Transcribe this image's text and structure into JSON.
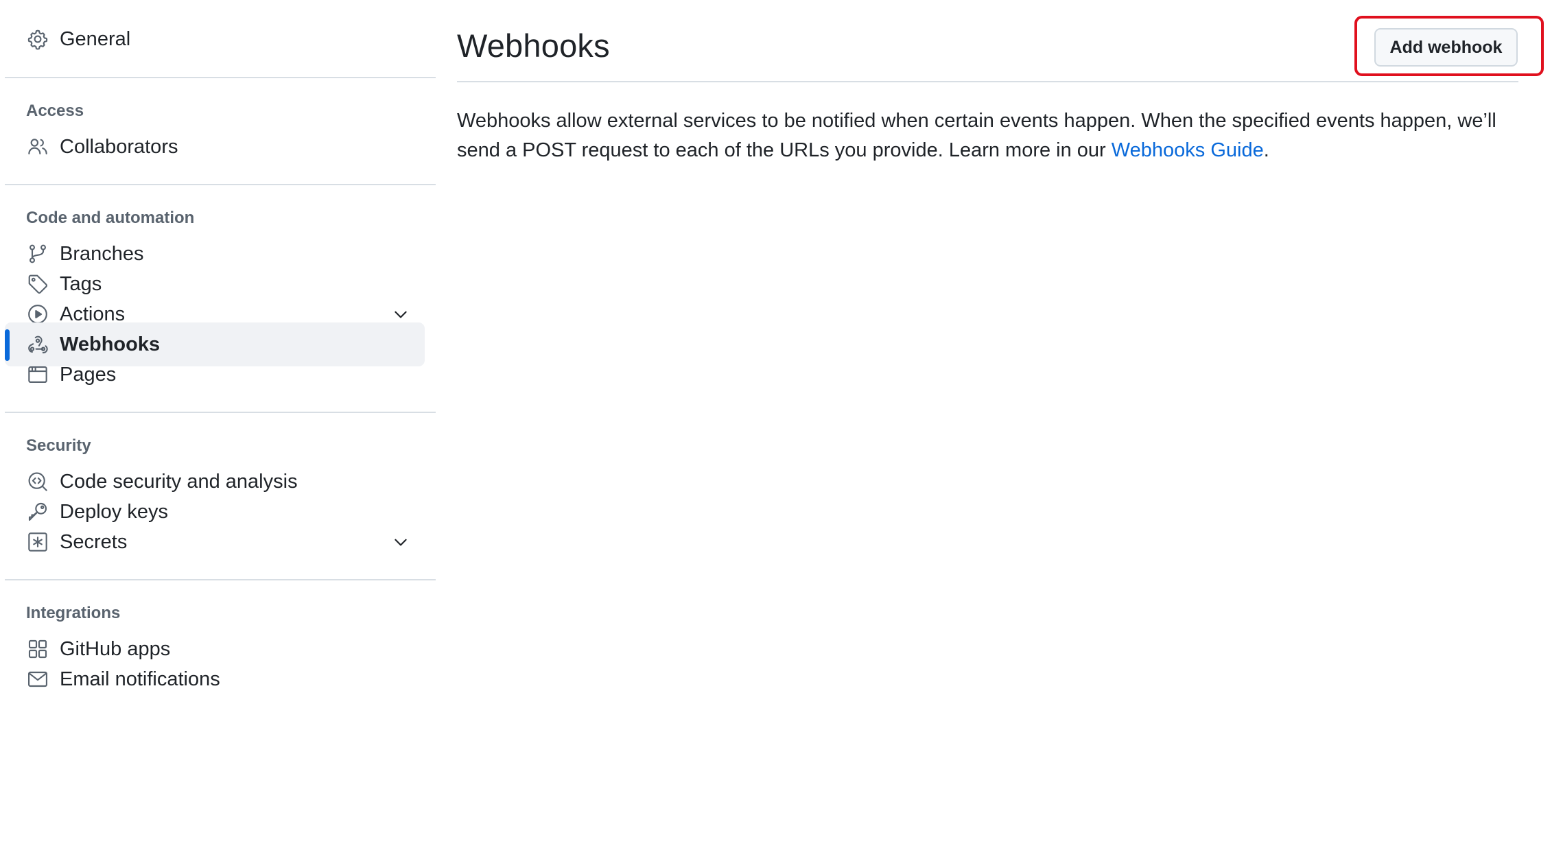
{
  "sidebar": {
    "general": {
      "label": "General",
      "icon": "gear-icon"
    },
    "sections": [
      {
        "title": "Access",
        "items": [
          {
            "label": "Collaborators",
            "icon": "people-icon"
          }
        ]
      },
      {
        "title": "Code and automation",
        "items": [
          {
            "label": "Branches",
            "icon": "git-branch-icon"
          },
          {
            "label": "Tags",
            "icon": "tag-icon"
          },
          {
            "label": "Actions",
            "icon": "play-icon",
            "expandable": true
          },
          {
            "label": "Webhooks",
            "icon": "webhook-icon",
            "active": true
          },
          {
            "label": "Pages",
            "icon": "browser-icon"
          }
        ]
      },
      {
        "title": "Security",
        "items": [
          {
            "label": "Code security and analysis",
            "icon": "codescan-icon"
          },
          {
            "label": "Deploy keys",
            "icon": "key-icon"
          },
          {
            "label": "Secrets",
            "icon": "asterisk-box-icon",
            "expandable": true
          }
        ]
      },
      {
        "title": "Integrations",
        "items": [
          {
            "label": "GitHub apps",
            "icon": "apps-grid-icon"
          },
          {
            "label": "Email notifications",
            "icon": "mail-icon"
          }
        ]
      }
    ]
  },
  "main": {
    "title": "Webhooks",
    "add_button_label": "Add webhook",
    "description_text": "Webhooks allow external services to be notified when certain events happen. When the specified events happen, we’ll send a POST request to each of the URLs you provide. Learn more in our ",
    "description_link": "Webhooks Guide",
    "description_end": "."
  },
  "colors": {
    "accent": "#0969da",
    "highlight_box": "#e0101e",
    "active_bg": "#f0f2f5",
    "section_title": "#59636e",
    "divider": "#d8dee4"
  }
}
